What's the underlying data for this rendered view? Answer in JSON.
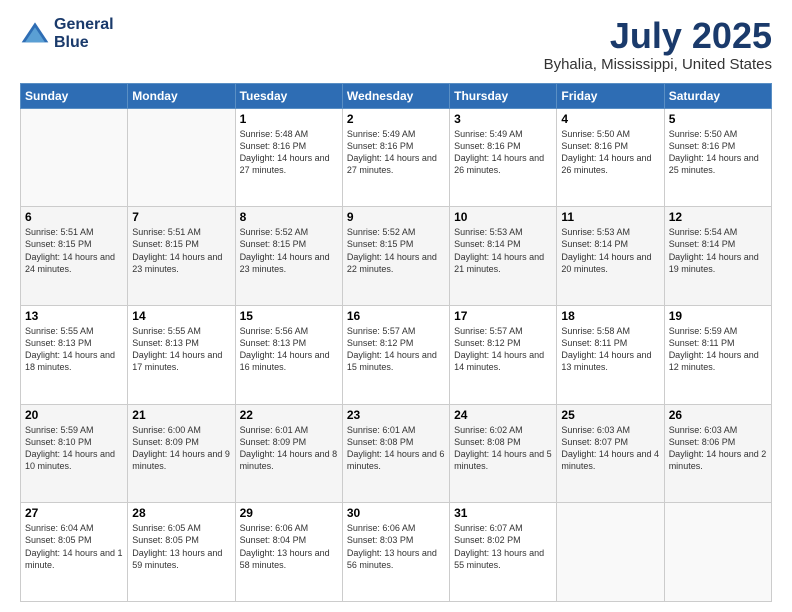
{
  "header": {
    "logo_line1": "General",
    "logo_line2": "Blue",
    "month": "July 2025",
    "location": "Byhalia, Mississippi, United States"
  },
  "days_of_week": [
    "Sunday",
    "Monday",
    "Tuesday",
    "Wednesday",
    "Thursday",
    "Friday",
    "Saturday"
  ],
  "weeks": [
    [
      {
        "day": "",
        "sunrise": "",
        "sunset": "",
        "daylight": ""
      },
      {
        "day": "",
        "sunrise": "",
        "sunset": "",
        "daylight": ""
      },
      {
        "day": "1",
        "sunrise": "Sunrise: 5:48 AM",
        "sunset": "Sunset: 8:16 PM",
        "daylight": "Daylight: 14 hours and 27 minutes."
      },
      {
        "day": "2",
        "sunrise": "Sunrise: 5:49 AM",
        "sunset": "Sunset: 8:16 PM",
        "daylight": "Daylight: 14 hours and 27 minutes."
      },
      {
        "day": "3",
        "sunrise": "Sunrise: 5:49 AM",
        "sunset": "Sunset: 8:16 PM",
        "daylight": "Daylight: 14 hours and 26 minutes."
      },
      {
        "day": "4",
        "sunrise": "Sunrise: 5:50 AM",
        "sunset": "Sunset: 8:16 PM",
        "daylight": "Daylight: 14 hours and 26 minutes."
      },
      {
        "day": "5",
        "sunrise": "Sunrise: 5:50 AM",
        "sunset": "Sunset: 8:16 PM",
        "daylight": "Daylight: 14 hours and 25 minutes."
      }
    ],
    [
      {
        "day": "6",
        "sunrise": "Sunrise: 5:51 AM",
        "sunset": "Sunset: 8:15 PM",
        "daylight": "Daylight: 14 hours and 24 minutes."
      },
      {
        "day": "7",
        "sunrise": "Sunrise: 5:51 AM",
        "sunset": "Sunset: 8:15 PM",
        "daylight": "Daylight: 14 hours and 23 minutes."
      },
      {
        "day": "8",
        "sunrise": "Sunrise: 5:52 AM",
        "sunset": "Sunset: 8:15 PM",
        "daylight": "Daylight: 14 hours and 23 minutes."
      },
      {
        "day": "9",
        "sunrise": "Sunrise: 5:52 AM",
        "sunset": "Sunset: 8:15 PM",
        "daylight": "Daylight: 14 hours and 22 minutes."
      },
      {
        "day": "10",
        "sunrise": "Sunrise: 5:53 AM",
        "sunset": "Sunset: 8:14 PM",
        "daylight": "Daylight: 14 hours and 21 minutes."
      },
      {
        "day": "11",
        "sunrise": "Sunrise: 5:53 AM",
        "sunset": "Sunset: 8:14 PM",
        "daylight": "Daylight: 14 hours and 20 minutes."
      },
      {
        "day": "12",
        "sunrise": "Sunrise: 5:54 AM",
        "sunset": "Sunset: 8:14 PM",
        "daylight": "Daylight: 14 hours and 19 minutes."
      }
    ],
    [
      {
        "day": "13",
        "sunrise": "Sunrise: 5:55 AM",
        "sunset": "Sunset: 8:13 PM",
        "daylight": "Daylight: 14 hours and 18 minutes."
      },
      {
        "day": "14",
        "sunrise": "Sunrise: 5:55 AM",
        "sunset": "Sunset: 8:13 PM",
        "daylight": "Daylight: 14 hours and 17 minutes."
      },
      {
        "day": "15",
        "sunrise": "Sunrise: 5:56 AM",
        "sunset": "Sunset: 8:13 PM",
        "daylight": "Daylight: 14 hours and 16 minutes."
      },
      {
        "day": "16",
        "sunrise": "Sunrise: 5:57 AM",
        "sunset": "Sunset: 8:12 PM",
        "daylight": "Daylight: 14 hours and 15 minutes."
      },
      {
        "day": "17",
        "sunrise": "Sunrise: 5:57 AM",
        "sunset": "Sunset: 8:12 PM",
        "daylight": "Daylight: 14 hours and 14 minutes."
      },
      {
        "day": "18",
        "sunrise": "Sunrise: 5:58 AM",
        "sunset": "Sunset: 8:11 PM",
        "daylight": "Daylight: 14 hours and 13 minutes."
      },
      {
        "day": "19",
        "sunrise": "Sunrise: 5:59 AM",
        "sunset": "Sunset: 8:11 PM",
        "daylight": "Daylight: 14 hours and 12 minutes."
      }
    ],
    [
      {
        "day": "20",
        "sunrise": "Sunrise: 5:59 AM",
        "sunset": "Sunset: 8:10 PM",
        "daylight": "Daylight: 14 hours and 10 minutes."
      },
      {
        "day": "21",
        "sunrise": "Sunrise: 6:00 AM",
        "sunset": "Sunset: 8:09 PM",
        "daylight": "Daylight: 14 hours and 9 minutes."
      },
      {
        "day": "22",
        "sunrise": "Sunrise: 6:01 AM",
        "sunset": "Sunset: 8:09 PM",
        "daylight": "Daylight: 14 hours and 8 minutes."
      },
      {
        "day": "23",
        "sunrise": "Sunrise: 6:01 AM",
        "sunset": "Sunset: 8:08 PM",
        "daylight": "Daylight: 14 hours and 6 minutes."
      },
      {
        "day": "24",
        "sunrise": "Sunrise: 6:02 AM",
        "sunset": "Sunset: 8:08 PM",
        "daylight": "Daylight: 14 hours and 5 minutes."
      },
      {
        "day": "25",
        "sunrise": "Sunrise: 6:03 AM",
        "sunset": "Sunset: 8:07 PM",
        "daylight": "Daylight: 14 hours and 4 minutes."
      },
      {
        "day": "26",
        "sunrise": "Sunrise: 6:03 AM",
        "sunset": "Sunset: 8:06 PM",
        "daylight": "Daylight: 14 hours and 2 minutes."
      }
    ],
    [
      {
        "day": "27",
        "sunrise": "Sunrise: 6:04 AM",
        "sunset": "Sunset: 8:05 PM",
        "daylight": "Daylight: 14 hours and 1 minute."
      },
      {
        "day": "28",
        "sunrise": "Sunrise: 6:05 AM",
        "sunset": "Sunset: 8:05 PM",
        "daylight": "Daylight: 13 hours and 59 minutes."
      },
      {
        "day": "29",
        "sunrise": "Sunrise: 6:06 AM",
        "sunset": "Sunset: 8:04 PM",
        "daylight": "Daylight: 13 hours and 58 minutes."
      },
      {
        "day": "30",
        "sunrise": "Sunrise: 6:06 AM",
        "sunset": "Sunset: 8:03 PM",
        "daylight": "Daylight: 13 hours and 56 minutes."
      },
      {
        "day": "31",
        "sunrise": "Sunrise: 6:07 AM",
        "sunset": "Sunset: 8:02 PM",
        "daylight": "Daylight: 13 hours and 55 minutes."
      },
      {
        "day": "",
        "sunrise": "",
        "sunset": "",
        "daylight": ""
      },
      {
        "day": "",
        "sunrise": "",
        "sunset": "",
        "daylight": ""
      }
    ]
  ]
}
